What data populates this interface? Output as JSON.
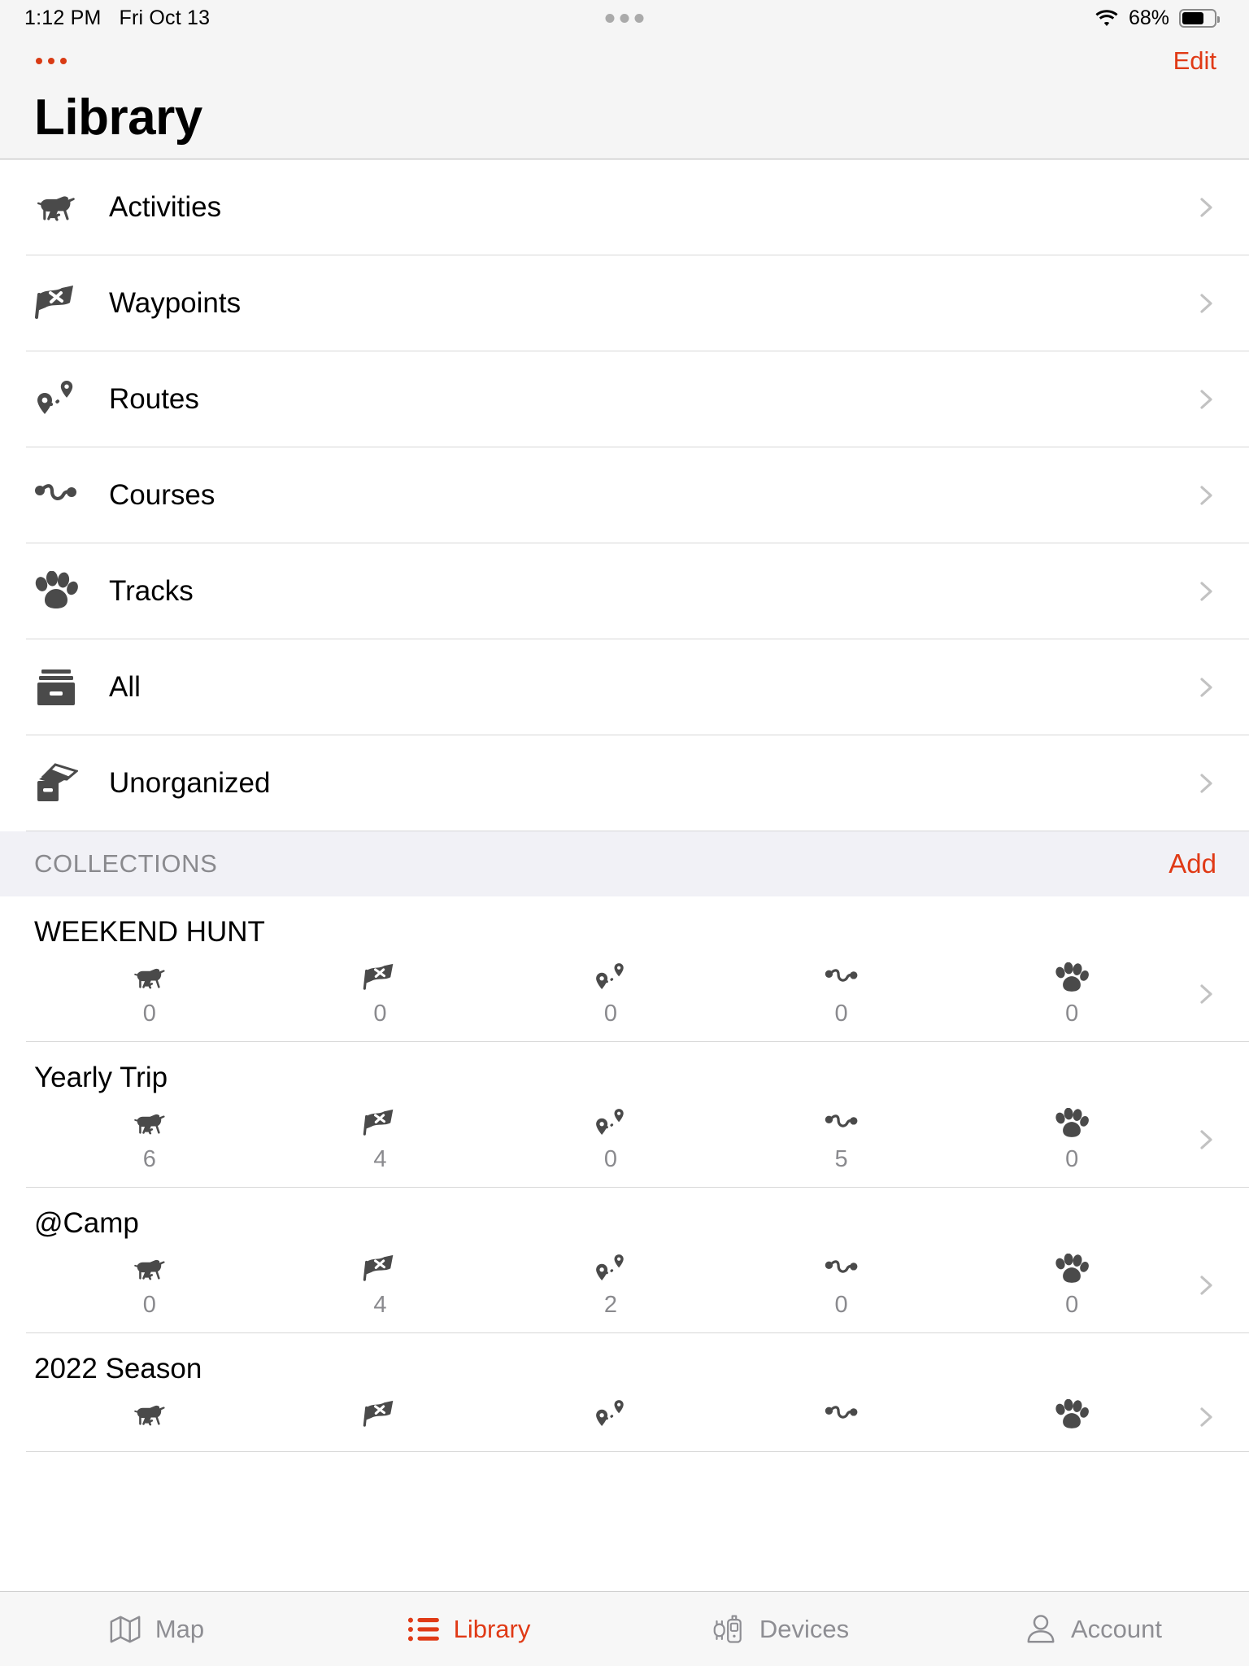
{
  "status_bar": {
    "time": "1:12 PM",
    "date": "Fri Oct 13",
    "battery_percent": "68%",
    "wifi_icon": "wifi-icon",
    "battery_icon": "battery-icon",
    "handle_icon": "multitask-handle-icon"
  },
  "nav": {
    "more_label": "…",
    "edit_label": "Edit",
    "title": "Library"
  },
  "library_items": [
    {
      "label": "Activities",
      "icon": "dog-icon"
    },
    {
      "label": "Waypoints",
      "icon": "flag-icon"
    },
    {
      "label": "Routes",
      "icon": "route-pins-icon"
    },
    {
      "label": "Courses",
      "icon": "squiggle-course-icon"
    },
    {
      "label": "Tracks",
      "icon": "paw-print-icon"
    },
    {
      "label": "All",
      "icon": "file-box-icon"
    },
    {
      "label": "Unorganized",
      "icon": "file-box-open-icon"
    }
  ],
  "collections_section": {
    "title": "COLLECTIONS",
    "add_label": "Add",
    "stat_icons": [
      "dog-icon",
      "flag-icon",
      "route-pins-icon",
      "squiggle-course-icon",
      "paw-print-icon"
    ],
    "items": [
      {
        "name": "WEEKEND HUNT",
        "counts": [
          "0",
          "0",
          "0",
          "0",
          "0"
        ]
      },
      {
        "name": "Yearly Trip",
        "counts": [
          "6",
          "4",
          "0",
          "5",
          "0"
        ]
      },
      {
        "name": "@Camp",
        "counts": [
          "0",
          "4",
          "2",
          "0",
          "0"
        ]
      },
      {
        "name": "2022 Season",
        "counts": [
          "",
          "",
          "",
          "",
          ""
        ]
      }
    ]
  },
  "tab_bar": {
    "tabs": [
      {
        "label": "Map",
        "icon": "map-icon",
        "active": false
      },
      {
        "label": "Library",
        "icon": "list-icon",
        "active": true
      },
      {
        "label": "Devices",
        "icon": "devices-icon",
        "active": false
      },
      {
        "label": "Account",
        "icon": "person-icon",
        "active": false
      }
    ]
  },
  "colors": {
    "accent": "#e03a16",
    "secondary_text": "#8a8a8e",
    "separator": "#d7d7d7",
    "section_bg": "#f1f1f6",
    "header_bg": "#f5f5f5"
  }
}
